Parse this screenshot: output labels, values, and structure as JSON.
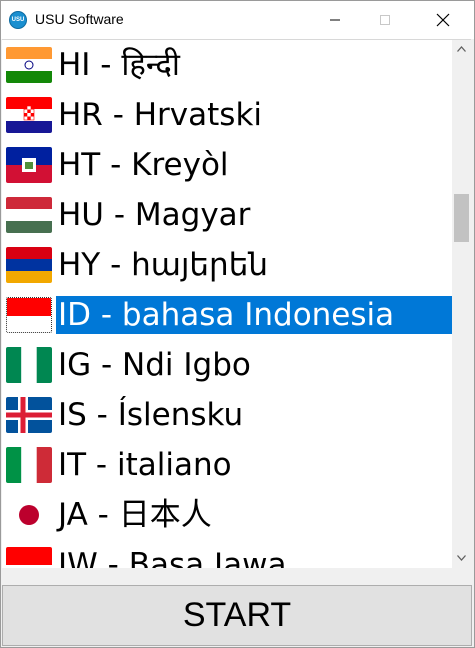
{
  "window": {
    "title": "USU Software",
    "logo_text": "USU"
  },
  "languages": [
    {
      "label": "HI - हिन्दी",
      "flag": "india-flag-icon",
      "selected": false
    },
    {
      "label": "HR - Hrvatski",
      "flag": "croatia-flag-icon",
      "selected": false
    },
    {
      "label": "HT - Kreyòl",
      "flag": "haiti-flag-icon",
      "selected": false
    },
    {
      "label": "HU - Magyar",
      "flag": "hungary-flag-icon",
      "selected": false
    },
    {
      "label": "HY - հայերեն",
      "flag": "armenia-flag-icon",
      "selected": false
    },
    {
      "label": "ID - bahasa Indonesia",
      "flag": "indonesia-flag-icon",
      "selected": true
    },
    {
      "label": "IG - Ndi Igbo",
      "flag": "nigeria-flag-icon",
      "selected": false
    },
    {
      "label": "IS - Íslensku",
      "flag": "iceland-flag-icon",
      "selected": false
    },
    {
      "label": "IT - italiano",
      "flag": "italy-flag-icon",
      "selected": false
    },
    {
      "label": "JA - 日本人",
      "flag": "japan-flag-icon",
      "selected": false
    },
    {
      "label": "JW - Basa Jawa",
      "flag": "indonesia-flag-icon",
      "selected": false
    }
  ],
  "start_button": {
    "label": "START"
  },
  "colors": {
    "selection": "#0078d7",
    "accent": "#1a8fd0"
  }
}
